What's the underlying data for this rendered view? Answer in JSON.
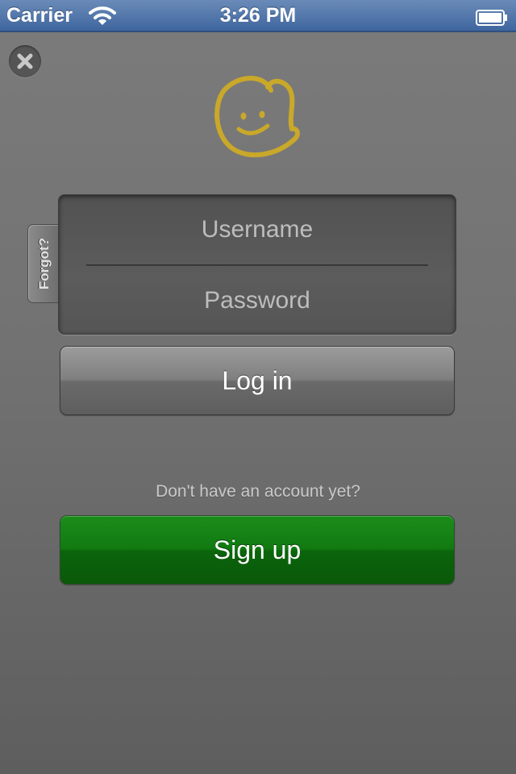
{
  "status_bar": {
    "carrier": "Carrier",
    "time": "3:26 PM",
    "wifi_icon": "wifi-icon",
    "battery_icon": "battery-icon"
  },
  "close_icon": "close-icon",
  "logo_icon": "smiley-logo-icon",
  "forgot": {
    "label": "Forgot?"
  },
  "login_form": {
    "username_placeholder": "Username",
    "username_value": "",
    "password_placeholder": "Password",
    "password_value": "",
    "login_label": "Log in"
  },
  "signup": {
    "prompt": "Don't have an account yet?",
    "button_label": "Sign up"
  },
  "colors": {
    "accent_logo": "#c9a82a",
    "signup_green": "#117a11",
    "status_bar_blue": "#4a6fa5"
  }
}
